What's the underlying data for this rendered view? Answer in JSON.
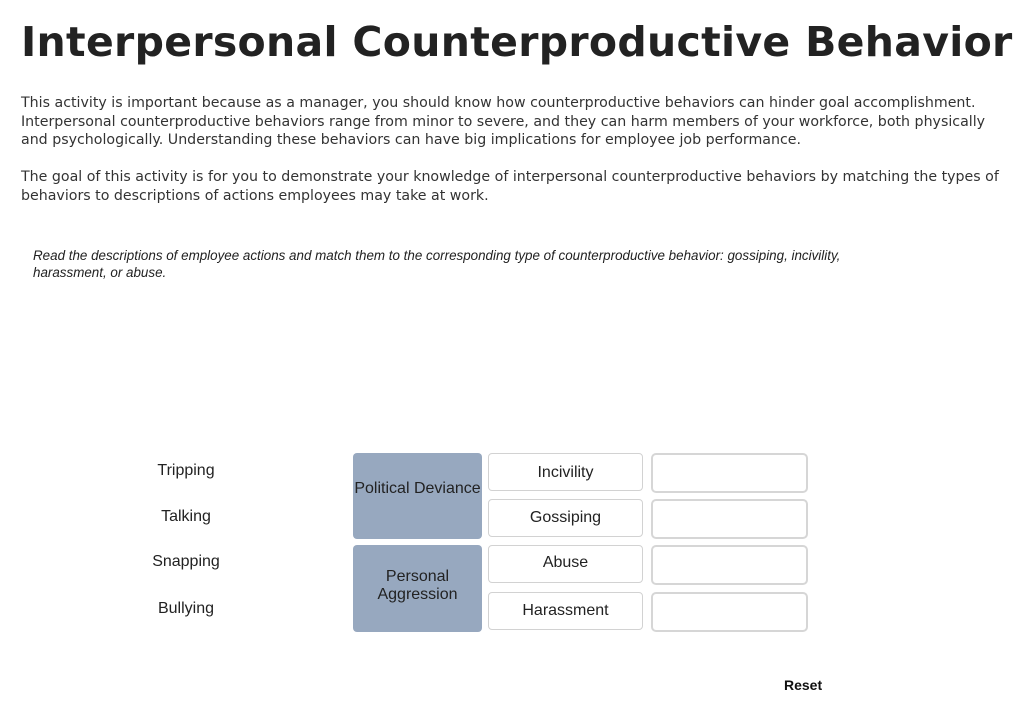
{
  "page": {
    "title": "Interpersonal Counterproductive Behavior",
    "intro_paragraphs": [
      "This activity is important because as a manager, you should know how counterproductive behaviors can hinder goal accomplishment. Interpersonal counterproductive behaviors range from minor to severe, and they can harm members of your workforce, both physically and psychologically. Understanding these behaviors can have big implications for employee job performance.",
      "The goal of this activity is for you to demonstrate your knowledge of interpersonal counterproductive behaviors by matching the types of behaviors to descriptions of actions employees may take at work."
    ],
    "instructions": "Read the descriptions of employee actions and match them to the corresponding type of counterproductive behavior: gossiping, incivility, harassment, or abuse."
  },
  "activity": {
    "actions": [
      "Tripping",
      "Talking",
      "Snapping",
      "Bullying"
    ],
    "categories": [
      {
        "label": "Political Deviance",
        "color": "#97a8bf",
        "terms": [
          "Incivility",
          "Gossiping"
        ]
      },
      {
        "label": "Personal Aggression",
        "color": "#97a8bf",
        "terms": [
          "Abuse",
          "Harassment"
        ]
      }
    ],
    "drop_targets": [
      "",
      "",
      "",
      ""
    ],
    "reset_label": "Reset"
  }
}
